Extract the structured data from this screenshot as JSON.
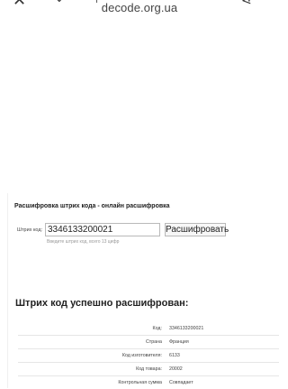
{
  "browser": {
    "url": "decode.org.ua",
    "close_icon_glyph": "✕",
    "download_icon_glyph": "⌄",
    "sliders_icon_glyph": "⊨",
    "share_icon_glyph": "⋖"
  },
  "form": {
    "heading": "Расшифровка штрих кода - онлайн расшифровка",
    "barcode_label": "Штрих код:",
    "barcode_value": "3346133200021",
    "decode_button_label": "Расшифровать",
    "hint": "Введите штрих код, всего 13 цифр"
  },
  "result": {
    "heading": "Штрих код успешно расшифрован:",
    "rows": [
      {
        "label": "Код:",
        "value": "3346133200021"
      },
      {
        "label": "Страна",
        "value": "Франция"
      },
      {
        "label": "Код изготовителя:",
        "value": "6133"
      },
      {
        "label": "Код товара:",
        "value": "20002"
      },
      {
        "label": "Контрольная сумма",
        "value": "Совпадает"
      }
    ]
  }
}
